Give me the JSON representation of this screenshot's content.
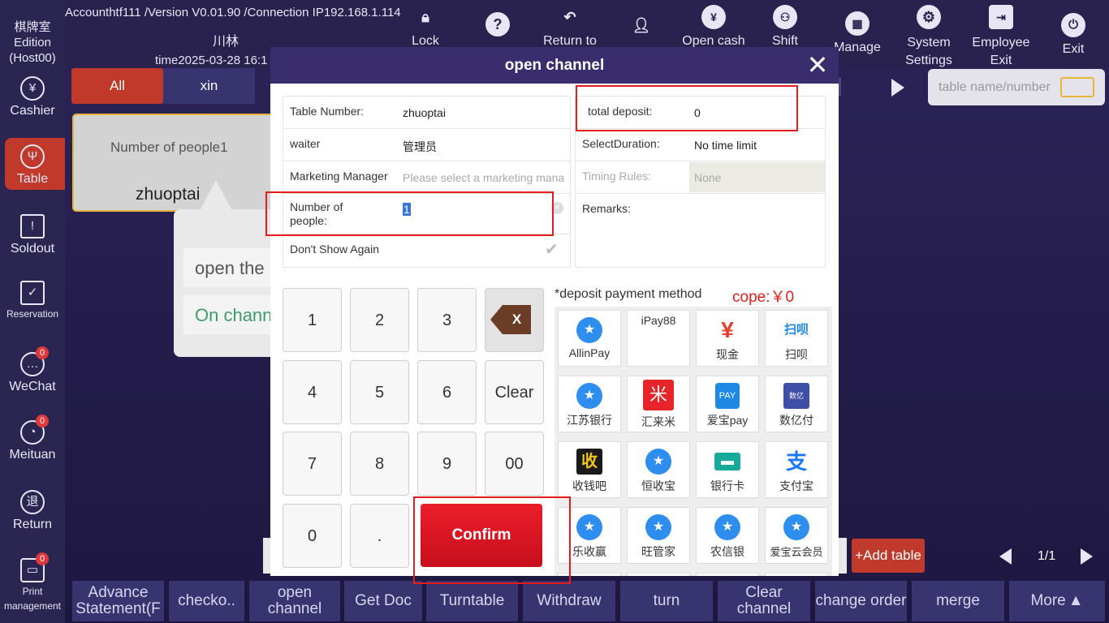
{
  "app": {
    "account_line": "Accounthtf111 /Version V0.01.90 /Connection IP192.168.1.114",
    "location": "川林",
    "time": "time2025-03-28 16:1",
    "edition": "棋牌室 Edition (Host00)"
  },
  "sidebar": {
    "items": [
      {
        "label": "Cashier",
        "icon": "yen-icon"
      },
      {
        "label": "Table",
        "icon": "fork-knife-icon"
      },
      {
        "label": "Soldout",
        "icon": "warning-icon"
      },
      {
        "label": "Reservation",
        "icon": "clipboard-icon"
      },
      {
        "label": "WeChat",
        "icon": "chat-icon",
        "badge": "0"
      },
      {
        "label": "Meituan",
        "icon": "meituan-icon",
        "badge": "0"
      },
      {
        "label": "Return",
        "icon": "return-icon"
      },
      {
        "label": "Print management",
        "icon": "printer-icon",
        "badge": "0"
      }
    ]
  },
  "topbar": {
    "buttons": [
      {
        "label": "Lock"
      },
      {
        "label": "Return to"
      },
      {
        "label": "Open cash"
      },
      {
        "label": "Shift"
      },
      {
        "label": "Manage"
      },
      {
        "label": "System Settings"
      },
      {
        "label": "Employee Exit"
      },
      {
        "label": "Exit"
      }
    ]
  },
  "tabs": {
    "all": "All",
    "xin": "xin"
  },
  "search": {
    "placeholder": "table name/number"
  },
  "table_card": {
    "people": "Number of people1",
    "name": "zhuoptai"
  },
  "popup": {
    "open": "open the",
    "on": "On chann"
  },
  "modal": {
    "title": "open channel",
    "table_number_label": "Table Number:",
    "table_number": "zhuoptai",
    "waiter_label": "waiter",
    "waiter": "管理员",
    "marketing_label": "Marketing Manager",
    "marketing_placeholder": "Please select a marketing mana",
    "people_label": "Number of people:",
    "people_value": "1",
    "dont_show_label": "Don't Show Again",
    "deposit_label": "total deposit:",
    "deposit_value": "0",
    "duration_label": "SelectDuration:",
    "duration_value": "No time limit",
    "timing_label": "Timing Rules:",
    "timing_value": "None",
    "remarks_label": "Remarks:",
    "keys": [
      "1",
      "2",
      "3",
      "4",
      "5",
      "6",
      "7",
      "8",
      "9",
      "0",
      ".",
      "00",
      "Clear",
      "Confirm"
    ],
    "deposit_method_label": "*deposit payment method",
    "cope": "cope:￥0",
    "pay_methods": [
      "AllinPay",
      "iPay88",
      "现金",
      "扫呗",
      "江苏银行",
      "汇来米",
      "爱宝pay",
      "数亿付",
      "收钱吧",
      "恒收宝",
      "银行卡",
      "支付宝",
      "乐收赢",
      "旺管家",
      "农信银",
      "爱宝云会员"
    ]
  },
  "bottom": {
    "buttons": [
      "Advance Statement(F",
      "checko..",
      "open channel",
      "Get Doc",
      "Turntable",
      "Withdraw",
      "turn",
      "Clear channel",
      "change order",
      "merge",
      "More"
    ],
    "add_table": "+Add table",
    "page": "1/1"
  },
  "colors": {
    "accent": "#e0393b",
    "confirm": "#d7141f",
    "header": "#3a2d6e"
  }
}
